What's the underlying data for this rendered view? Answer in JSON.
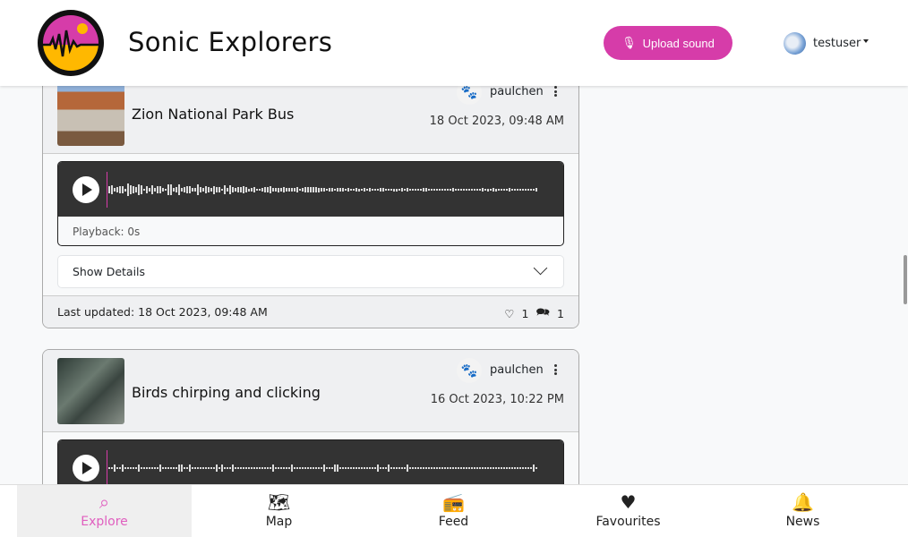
{
  "header": {
    "brand": "Sonic Explorers",
    "upload_label": "Upload sound",
    "username": "testuser"
  },
  "colors": {
    "accent": "#d63ca9",
    "logo_top": "#d63ca9",
    "logo_bottom": "#ffb800"
  },
  "sounds": [
    {
      "title": "Zion National Park Bus",
      "user": "paulchen",
      "date": "18 Oct 2023, 09:48 AM",
      "playback": "Playback: 0s",
      "details_label": "Show Details",
      "last_updated": "Last updated: 18 Oct 2023, 09:48 AM",
      "likes": "1",
      "comments": "1"
    },
    {
      "title": "Birds chirping and clicking",
      "user": "paulchen",
      "date": "16 Oct 2023, 10:22 PM"
    }
  ],
  "nav": [
    {
      "label": "Explore",
      "icon": "explore-pin-icon",
      "active": true
    },
    {
      "label": "Map",
      "icon": "map-icon"
    },
    {
      "label": "Feed",
      "icon": "radio-icon"
    },
    {
      "label": "Favourites",
      "icon": "heart-pulse-icon"
    },
    {
      "label": "News",
      "icon": "bell-icon"
    }
  ]
}
